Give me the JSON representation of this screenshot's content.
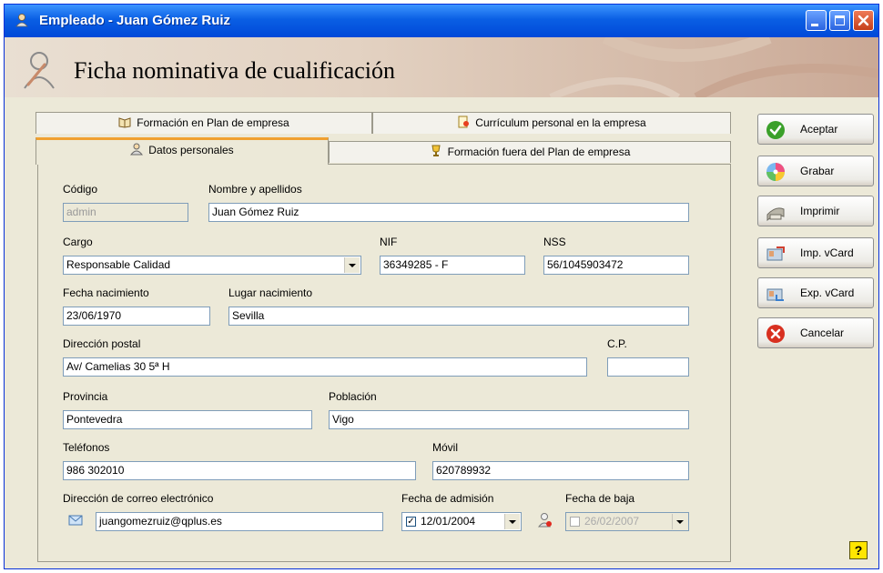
{
  "window": {
    "title": "Empleado - Juan Gómez Ruiz"
  },
  "header": {
    "title": "Ficha nominativa de cualificación"
  },
  "tabs": {
    "back": [
      {
        "label": "Formación en Plan de empresa",
        "icon": "book-icon"
      },
      {
        "label": "Currículum personal en la empresa",
        "icon": "document-icon"
      }
    ],
    "front": [
      {
        "label": "Datos personales",
        "icon": "person-icon",
        "active": true
      },
      {
        "label": "Formación fuera del Plan de empresa",
        "icon": "trophy-icon"
      }
    ]
  },
  "form": {
    "codigo": {
      "label": "Código",
      "value": "admin"
    },
    "nombre": {
      "label": "Nombre y apellidos",
      "value": "Juan Gómez Ruiz"
    },
    "cargo": {
      "label": "Cargo",
      "value": "Responsable Calidad"
    },
    "nif": {
      "label": "NIF",
      "value": "36349285 - F"
    },
    "nss": {
      "label": "NSS",
      "value": "56/1045903472"
    },
    "fecha_nacimiento": {
      "label": "Fecha nacimiento",
      "value": "23/06/1970"
    },
    "lugar_nacimiento": {
      "label": "Lugar nacimiento",
      "value": "Sevilla"
    },
    "direccion": {
      "label": "Dirección postal",
      "value": "Av/ Camelias 30 5ª H"
    },
    "cp": {
      "label": "C.P.",
      "value": ""
    },
    "provincia": {
      "label": "Provincia",
      "value": "Pontevedra"
    },
    "poblacion": {
      "label": "Población",
      "value": "Vigo"
    },
    "telefonos": {
      "label": "Teléfonos",
      "value": "986 302010"
    },
    "movil": {
      "label": "Móvil",
      "value": "620789932"
    },
    "email": {
      "label": "Dirección de correo electrónico",
      "value": "juangomezruiz@qplus.es"
    },
    "fecha_admision": {
      "label": "Fecha de admisión",
      "value": "12/01/2004",
      "checked": true
    },
    "fecha_baja": {
      "label": "Fecha de baja",
      "value": "26/02/2007",
      "checked": false
    }
  },
  "actions": [
    {
      "label": "Aceptar",
      "icon": "checkmark-icon"
    },
    {
      "label": "Grabar",
      "icon": "disc-icon"
    },
    {
      "label": "Imprimir",
      "icon": "printer-icon"
    },
    {
      "label": "Imp. vCard",
      "icon": "import-card-icon"
    },
    {
      "label": "Exp. vCard",
      "icon": "export-card-icon"
    },
    {
      "label": "Cancelar",
      "icon": "cancel-icon"
    }
  ],
  "help": {
    "label": "?"
  }
}
